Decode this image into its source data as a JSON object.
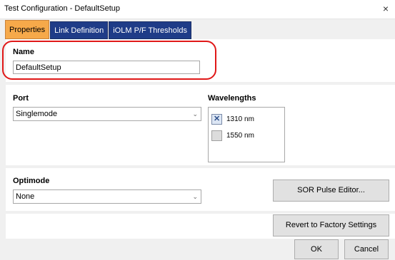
{
  "window": {
    "title": "Test Configuration - DefaultSetup",
    "close_glyph": "×"
  },
  "tabs": [
    {
      "label": "Properties",
      "active": true
    },
    {
      "label": "Link Definition",
      "active": false
    },
    {
      "label": "iOLM P/F Thresholds",
      "active": false
    }
  ],
  "name_section": {
    "label": "Name",
    "value": "DefaultSetup"
  },
  "port_section": {
    "label": "Port",
    "selected": "Singlemode"
  },
  "wavelengths": {
    "label": "Wavelengths",
    "items": [
      {
        "label": "1310 nm",
        "checked": true
      },
      {
        "label": "1550 nm",
        "checked": false
      }
    ]
  },
  "optimode_section": {
    "label": "Optimode",
    "selected": "None"
  },
  "buttons": {
    "sor_pulse_editor": "SOR Pulse Editor...",
    "revert": "Revert to Factory Settings",
    "ok": "OK",
    "cancel": "Cancel"
  },
  "icons": {
    "dropdown": "chevron-down-icon",
    "close": "close-icon",
    "check": "checkmark-x-icon"
  },
  "colors": {
    "active_tab": "#f6a94a",
    "inactive_tab": "#1f3c88",
    "highlight": "#e01818"
  }
}
